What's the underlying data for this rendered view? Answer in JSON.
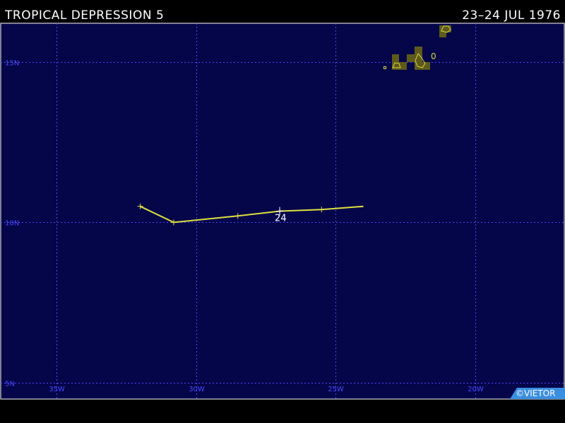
{
  "header": {
    "title": "TROPICAL DEPRESSION 5",
    "dates": "23–24 JUL 1976"
  },
  "map": {
    "lat_range": [
      4.5,
      16.2
    ],
    "lon_range": [
      -37.0,
      -16.8
    ],
    "lat_labels": [
      {
        "value": 15,
        "text": "15N"
      },
      {
        "value": 10,
        "text": "10N"
      },
      {
        "value": 5,
        "text": "5N"
      }
    ],
    "lon_labels": [
      {
        "value": -35,
        "text": "35W"
      },
      {
        "value": -30,
        "text": "30W"
      },
      {
        "value": -25,
        "text": "25W"
      },
      {
        "value": -20,
        "text": "20W"
      }
    ],
    "colors": {
      "ocean": "#05054a",
      "grid": "#4a4aff",
      "track": "#e0e040",
      "land": "#5e5a1c",
      "coast": "#d8d840",
      "credit_bg": "#3a8ee0"
    }
  },
  "storm_track": {
    "points": [
      {
        "lon": -32.0,
        "lat": 10.5
      },
      {
        "lon": -30.8,
        "lat": 10.0
      },
      {
        "lon": -28.5,
        "lat": 10.2
      },
      {
        "lon": -27.0,
        "lat": 10.35
      },
      {
        "lon": -25.5,
        "lat": 10.4
      },
      {
        "lon": -24.0,
        "lat": 10.5
      }
    ],
    "date_markers": [
      {
        "lon": -27.0,
        "lat": 10.35,
        "text": "24"
      }
    ]
  },
  "islands": {
    "label_zero": "0"
  },
  "credit": "©VIETOR"
}
